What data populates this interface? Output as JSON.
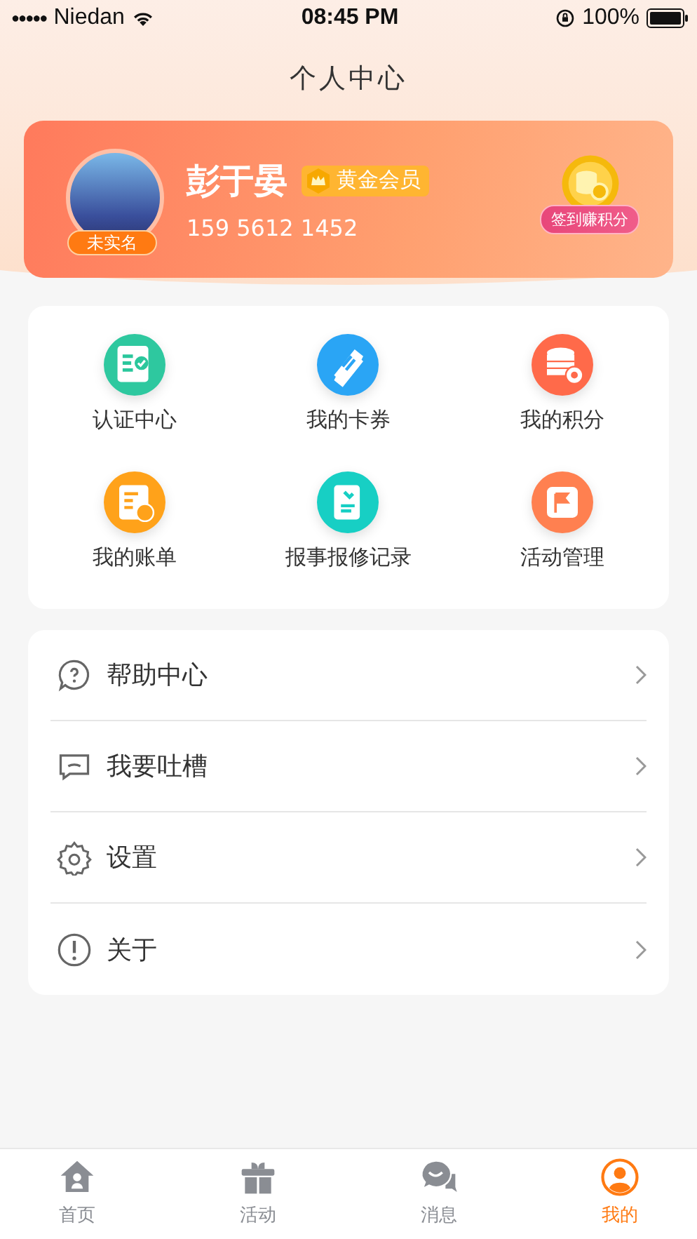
{
  "status_bar": {
    "signal_dots": "●●●●●",
    "carrier": "Niedan",
    "time": "08:45 PM",
    "battery": "100%"
  },
  "title": "个人中心",
  "profile": {
    "name": "彭于晏",
    "member_badge": "黄金会员",
    "phone": "159 5612 1452",
    "verify_tag": "未实名",
    "checkin_button": "签到赚积分"
  },
  "services": [
    {
      "kind": "certify",
      "label": "认证中心"
    },
    {
      "kind": "coupon",
      "label": "我的卡券"
    },
    {
      "kind": "points",
      "label": "我的积分"
    },
    {
      "kind": "bill",
      "label": "我的账单"
    },
    {
      "kind": "repair",
      "label": "报事报修记录"
    },
    {
      "kind": "activity",
      "label": "活动管理"
    }
  ],
  "menu": [
    {
      "kind": "help",
      "label": "帮助中心"
    },
    {
      "kind": "feedback",
      "label": "我要吐槽"
    },
    {
      "kind": "settings",
      "label": "设置"
    },
    {
      "kind": "about",
      "label": "关于"
    }
  ],
  "tabs": [
    {
      "kind": "home",
      "label": "首页",
      "selected": false
    },
    {
      "kind": "gift",
      "label": "活动",
      "selected": false
    },
    {
      "kind": "chat",
      "label": "消息",
      "selected": false
    },
    {
      "kind": "user",
      "label": "我的",
      "selected": true
    }
  ]
}
